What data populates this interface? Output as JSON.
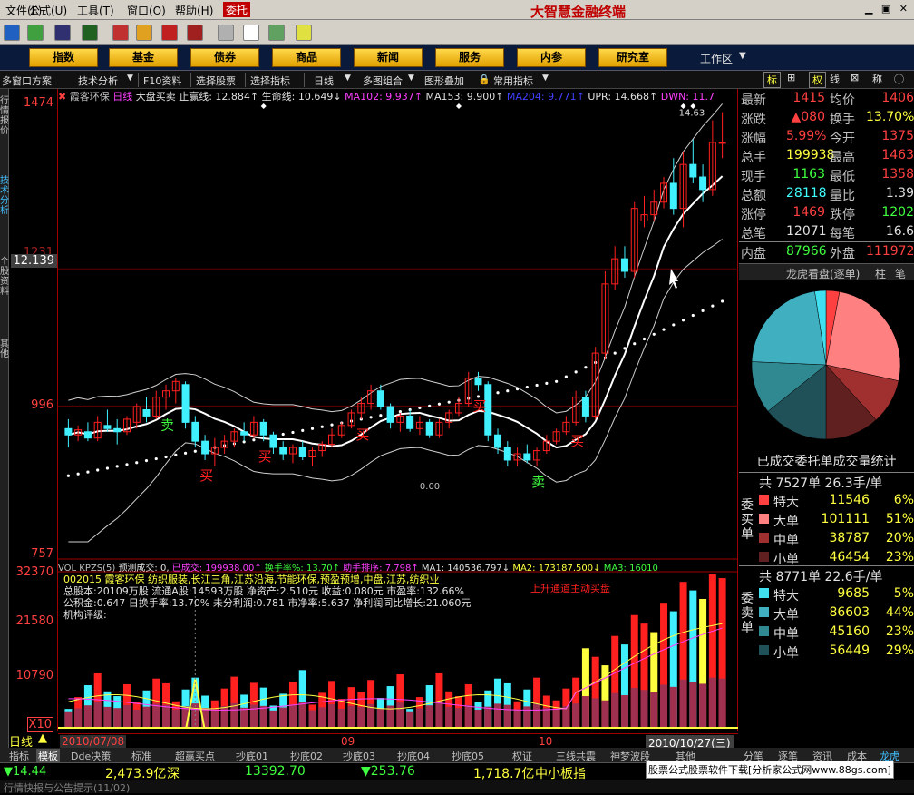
{
  "menu": {
    "items": [
      "文件(F)",
      "公式(U)",
      "工具(T)",
      "窗口(O)",
      "帮助(H)",
      "委托"
    ],
    "brand": "大智慧金融终端"
  },
  "nav": {
    "items": [
      "指数",
      "基金",
      "债券",
      "商品",
      "新闻",
      "服务",
      "内参",
      "研究室"
    ],
    "workspace": "工作区"
  },
  "toolbar": {
    "items": [
      "多窗口方案",
      "技术分析",
      "F10资料",
      "选择股票",
      "选择指标",
      "日线",
      "多图组合",
      "图形叠加",
      "常用指标"
    ],
    "right_tabs": [
      "标",
      "权",
      "线",
      "称"
    ]
  },
  "side_labels": [
    "行情报价",
    "技术分析",
    "个股资料",
    "其他"
  ],
  "chart": {
    "info": {
      "name": "霞客环保",
      "period": "日线",
      "strategy": "大盘买卖",
      "stop": "止赢线: 12.884↑",
      "life": "生命线: 10.649↓",
      "ma102": "MA102: 9.937↑",
      "ma153": "MA153: 9.900↑",
      "ma204": "MA204: 9.771↑",
      "upr": "UPR: 14.668↑",
      "dwn": "DWN: 11.7"
    },
    "y_labels": [
      "1474",
      "1231",
      "12.139",
      "996",
      "757"
    ],
    "price_high_label": "14.63",
    "vol_y_labels": [
      "32370",
      "21580",
      "10790",
      "X10"
    ],
    "vol_info": {
      "title": "VOL KPZS(5)",
      "forecast": "预测成交: 0,",
      "done": "已成交: 199938.00↑",
      "turnover": "换手率%: 13.70↑",
      "rank": "助手排序: 7.798↑",
      "ma1": "MA1: 140536.797↓",
      "ma2": "MA2: 173187.500↓",
      "ma3": "MA3: 16010"
    },
    "vol_annotation": "上升通道主动买盘",
    "low_marker": "0.00",
    "buy_label": "买",
    "sell_label": "卖",
    "fundamentals": [
      "002015 霞客环保 纺织服装,长江三角,江苏沿海,节能环保,预盈预增,中盘,江苏,纺织业",
      "总股本:20109万股 流通A股:14593万股 净资产:2.510元 收益:0.080元 市盈率:132.66%",
      "公积金:0.647 日换手率:13.70% 未分利润:0.781 市净率:5.637 净利润同比增长:21.060元",
      "机构评级:"
    ],
    "period_label": "日线",
    "dates": {
      "start": "2010/07/08",
      "m9": "09",
      "m10": "10",
      "end": "2010/10/27(三)"
    }
  },
  "chart_data": {
    "type": "candlestick",
    "ylim": [
      7.57,
      14.74
    ],
    "candles": [
      {
        "o": 9.6,
        "h": 9.75,
        "l": 9.3,
        "c": 9.5
      },
      {
        "o": 9.5,
        "h": 9.65,
        "l": 9.4,
        "c": 9.58
      },
      {
        "o": 9.55,
        "h": 9.7,
        "l": 9.4,
        "c": 9.45
      },
      {
        "o": 9.45,
        "h": 9.8,
        "l": 9.4,
        "c": 9.7
      },
      {
        "o": 9.65,
        "h": 9.9,
        "l": 9.55,
        "c": 9.6
      },
      {
        "o": 9.6,
        "h": 9.75,
        "l": 9.35,
        "c": 9.55
      },
      {
        "o": 9.55,
        "h": 9.8,
        "l": 9.5,
        "c": 9.75
      },
      {
        "o": 9.7,
        "h": 10.0,
        "l": 9.6,
        "c": 9.95
      },
      {
        "o": 9.9,
        "h": 10.1,
        "l": 9.7,
        "c": 9.8
      },
      {
        "o": 9.8,
        "h": 10.2,
        "l": 9.75,
        "c": 10.1
      },
      {
        "o": 10.1,
        "h": 10.3,
        "l": 9.9,
        "c": 10.2
      },
      {
        "o": 10.2,
        "h": 10.4,
        "l": 10.0,
        "c": 10.35
      },
      {
        "o": 10.3,
        "h": 10.35,
        "l": 9.6,
        "c": 9.7
      },
      {
        "o": 9.7,
        "h": 9.8,
        "l": 9.3,
        "c": 9.4
      },
      {
        "o": 9.4,
        "h": 9.5,
        "l": 9.1,
        "c": 9.2
      },
      {
        "o": 9.2,
        "h": 9.45,
        "l": 9.0,
        "c": 9.3
      },
      {
        "o": 9.3,
        "h": 9.5,
        "l": 9.2,
        "c": 9.4
      },
      {
        "o": 9.4,
        "h": 9.6,
        "l": 9.3,
        "c": 9.55
      },
      {
        "o": 9.55,
        "h": 9.7,
        "l": 9.4,
        "c": 9.5
      },
      {
        "o": 9.5,
        "h": 9.8,
        "l": 9.45,
        "c": 9.7
      },
      {
        "o": 9.7,
        "h": 9.75,
        "l": 9.4,
        "c": 9.5
      },
      {
        "o": 9.5,
        "h": 9.55,
        "l": 9.2,
        "c": 9.3
      },
      {
        "o": 9.3,
        "h": 9.4,
        "l": 9.1,
        "c": 9.2
      },
      {
        "o": 9.2,
        "h": 9.35,
        "l": 9.05,
        "c": 9.3
      },
      {
        "o": 9.3,
        "h": 9.4,
        "l": 9.1,
        "c": 9.15
      },
      {
        "o": 9.15,
        "h": 9.3,
        "l": 9.0,
        "c": 9.25
      },
      {
        "o": 9.25,
        "h": 9.4,
        "l": 9.15,
        "c": 9.35
      },
      {
        "o": 9.35,
        "h": 9.6,
        "l": 9.3,
        "c": 9.5
      },
      {
        "o": 9.5,
        "h": 9.7,
        "l": 9.45,
        "c": 9.65
      },
      {
        "o": 9.65,
        "h": 9.9,
        "l": 9.6,
        "c": 9.85
      },
      {
        "o": 9.85,
        "h": 10.1,
        "l": 9.75,
        "c": 10.0
      },
      {
        "o": 10.0,
        "h": 10.3,
        "l": 9.9,
        "c": 10.2
      },
      {
        "o": 10.2,
        "h": 10.3,
        "l": 9.9,
        "c": 9.95
      },
      {
        "o": 9.95,
        "h": 10.0,
        "l": 9.6,
        "c": 9.7
      },
      {
        "o": 9.7,
        "h": 9.85,
        "l": 9.55,
        "c": 9.8
      },
      {
        "o": 9.8,
        "h": 9.9,
        "l": 9.55,
        "c": 9.6
      },
      {
        "o": 9.6,
        "h": 9.8,
        "l": 9.5,
        "c": 9.7
      },
      {
        "o": 9.7,
        "h": 9.75,
        "l": 9.45,
        "c": 9.5
      },
      {
        "o": 9.5,
        "h": 9.75,
        "l": 9.45,
        "c": 9.7
      },
      {
        "o": 9.7,
        "h": 9.9,
        "l": 9.6,
        "c": 9.85
      },
      {
        "o": 9.85,
        "h": 10.1,
        "l": 9.8,
        "c": 10.0
      },
      {
        "o": 10.0,
        "h": 10.5,
        "l": 9.95,
        "c": 10.4
      },
      {
        "o": 10.4,
        "h": 10.5,
        "l": 10.2,
        "c": 10.3
      },
      {
        "o": 10.3,
        "h": 10.35,
        "l": 9.4,
        "c": 9.5
      },
      {
        "o": 9.5,
        "h": 9.6,
        "l": 9.2,
        "c": 9.3
      },
      {
        "o": 9.3,
        "h": 9.4,
        "l": 9.0,
        "c": 9.1
      },
      {
        "o": 9.1,
        "h": 9.3,
        "l": 9.0,
        "c": 9.2
      },
      {
        "o": 9.2,
        "h": 9.35,
        "l": 9.05,
        "c": 9.1
      },
      {
        "o": 9.1,
        "h": 9.3,
        "l": 9.0,
        "c": 9.25
      },
      {
        "o": 9.25,
        "h": 9.5,
        "l": 9.2,
        "c": 9.4
      },
      {
        "o": 9.4,
        "h": 9.6,
        "l": 9.35,
        "c": 9.55
      },
      {
        "o": 9.55,
        "h": 9.8,
        "l": 9.5,
        "c": 9.7
      },
      {
        "o": 9.7,
        "h": 10.2,
        "l": 9.65,
        "c": 10.1
      },
      {
        "o": 10.1,
        "h": 10.2,
        "l": 9.7,
        "c": 9.8
      },
      {
        "o": 9.8,
        "h": 10.9,
        "l": 9.75,
        "c": 10.8
      },
      {
        "o": 10.8,
        "h": 12.1,
        "l": 10.7,
        "c": 11.9
      },
      {
        "o": 11.9,
        "h": 12.5,
        "l": 11.8,
        "c": 12.3
      },
      {
        "o": 12.3,
        "h": 12.5,
        "l": 12.0,
        "c": 12.1
      },
      {
        "o": 12.1,
        "h": 13.2,
        "l": 12.0,
        "c": 13.1
      },
      {
        "o": 12.9,
        "h": 13.3,
        "l": 12.8,
        "c": 13.0
      },
      {
        "o": 13.0,
        "h": 13.4,
        "l": 12.9,
        "c": 13.2
      },
      {
        "o": 13.2,
        "h": 13.6,
        "l": 13.1,
        "c": 13.5
      },
      {
        "o": 13.5,
        "h": 13.9,
        "l": 13.0,
        "c": 13.1
      },
      {
        "o": 13.1,
        "h": 14.0,
        "l": 12.8,
        "c": 13.8
      },
      {
        "o": 13.8,
        "h": 14.2,
        "l": 13.5,
        "c": 13.6
      },
      {
        "o": 13.6,
        "h": 13.8,
        "l": 13.2,
        "c": 13.4
      },
      {
        "o": 13.4,
        "h": 14.5,
        "l": 13.3,
        "c": 14.15
      },
      {
        "o": 14.15,
        "h": 14.63,
        "l": 13.9,
        "c": 14.15
      }
    ],
    "volume_ylim": [
      0,
      32370
    ],
    "order_stats": {
      "buy": [
        {
          "label": "特大",
          "value": 11546,
          "pct": 6
        },
        {
          "label": "大单",
          "value": 101111,
          "pct": 51
        },
        {
          "label": "中单",
          "value": 38787,
          "pct": 20
        },
        {
          "label": "小单",
          "value": 46454,
          "pct": 23
        }
      ],
      "sell": [
        {
          "label": "特大",
          "value": 9685,
          "pct": 5
        },
        {
          "label": "大单",
          "value": 86603,
          "pct": 44
        },
        {
          "label": "中单",
          "value": 45160,
          "pct": 23
        },
        {
          "label": "小单",
          "value": 56449,
          "pct": 29
        }
      ]
    }
  },
  "quote": {
    "rows": [
      {
        "k1": "最新",
        "v1": "1415",
        "k2": "均价",
        "v2": "1406"
      },
      {
        "k1": "涨跌",
        "v1": "▲080",
        "k2": "换手",
        "v2": "13.70%"
      },
      {
        "k1": "涨幅",
        "v1": "5.99%",
        "k2": "今开",
        "v2": "1375"
      },
      {
        "k1": "总手",
        "v1": "199938",
        "k2": "最高",
        "v2": "1463"
      },
      {
        "k1": "现手",
        "v1": "1163",
        "k2": "最低",
        "v2": "1358"
      },
      {
        "k1": "总额",
        "v1": "28118",
        "k2": "量比",
        "v2": "1.39"
      },
      {
        "k1": "涨停",
        "v1": "1469",
        "k2": "跌停",
        "v2": "1202"
      },
      {
        "k1": "总笔",
        "v1": "12071",
        "k2": "每笔",
        "v2": "16.6"
      },
      {
        "k1": "内盘",
        "v1": "87966",
        "k2": "外盘",
        "v2": "111972"
      }
    ],
    "dragon": "龙虎看盘(逐单)",
    "tab_zhu": "柱",
    "tab_bi": "笔",
    "stats_title": "已成交委托单成交量统计",
    "buy_total": "共 7527单 26.3手/单",
    "sell_total": "共 8771单 22.6手/单",
    "buy_side": "委买单",
    "sell_side": "委卖单",
    "buy_rows": [
      {
        "k": "特大",
        "v": "11546",
        "p": "6%"
      },
      {
        "k": "大单",
        "v": "101111",
        "p": "51%"
      },
      {
        "k": "中单",
        "v": "38787",
        "p": "20%"
      },
      {
        "k": "小单",
        "v": "46454",
        "p": "23%"
      }
    ],
    "sell_rows": [
      {
        "k": "特大",
        "v": "9685",
        "p": "5%"
      },
      {
        "k": "大单",
        "v": "86603",
        "p": "44%"
      },
      {
        "k": "中单",
        "v": "45160",
        "p": "23%"
      },
      {
        "k": "小单",
        "v": "56449",
        "p": "29%"
      }
    ],
    "right_bottom_tabs": [
      "分笔",
      "逐笔",
      "资讯",
      "成本",
      "龙虎"
    ]
  },
  "bottom_tabs": [
    "指标",
    "模板",
    "Dde决策",
    "标准",
    "超赢买点",
    "抄底01",
    "抄底02",
    "抄底03",
    "抄底04",
    "抄底05",
    "权证",
    "三线共震",
    "神梦波段",
    "其他"
  ],
  "status": {
    "v1": "▼14.44",
    "v2": "2,473.9亿",
    "v3": "深",
    "v4": "13392.70",
    "v5": "▼253.76",
    "v6": "1,718.7亿",
    "v7": "中小板指",
    "ad": "股票公式股票软件下载[分析家公式网www.88gs.com]"
  },
  "strip": "行情快报与公告提示(11/02)",
  "colors": {
    "up": "#ff2020",
    "down": "#40f0ff",
    "yellow": "#ffff40",
    "magenta": "#ff40ff",
    "green": "#40ff40"
  }
}
